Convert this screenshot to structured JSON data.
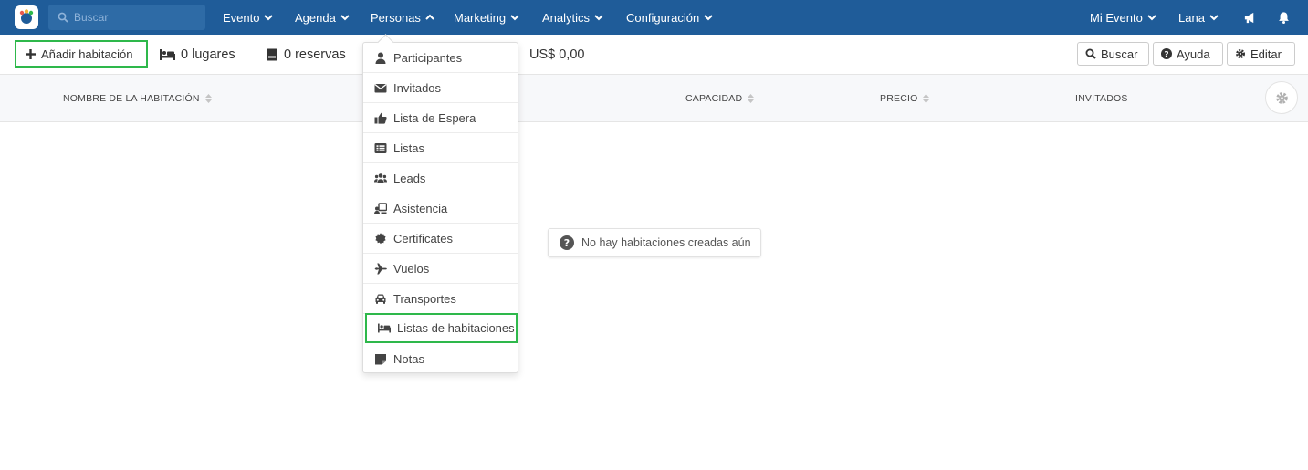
{
  "topbar": {
    "search_placeholder": "Buscar",
    "nav": [
      {
        "label": "Evento"
      },
      {
        "label": "Agenda"
      },
      {
        "label": "Personas"
      },
      {
        "label": "Marketing"
      },
      {
        "label": "Analytics"
      },
      {
        "label": "Configuración"
      }
    ],
    "right": {
      "event_label": "Mi Evento",
      "user_label": "Lana"
    },
    "colors": {
      "bar": "#1f5c99",
      "accent": "#2eb84b"
    }
  },
  "toolbar": {
    "add_label": "Añadir habitación",
    "places": "0 lugares",
    "reservations": "0 reservas",
    "amount": "US$ 0,00",
    "search_label": "Buscar",
    "help_label": "Ayuda",
    "edit_label": "Editar"
  },
  "table": {
    "columns": [
      {
        "label": "NOMBRE DE LA HABITACIÓN"
      },
      {
        "label": "CAPACIDAD"
      },
      {
        "label": "PRECIO"
      },
      {
        "label": "INVITADOS"
      }
    ]
  },
  "empty_state": "No hay habitaciones creadas aún",
  "dropdown": {
    "items": [
      {
        "label": "Participantes",
        "icon": "user-icon"
      },
      {
        "label": "Invitados",
        "icon": "envelope-icon"
      },
      {
        "label": "Lista de Espera",
        "icon": "thumbs-up-icon"
      },
      {
        "label": "Listas",
        "icon": "list-icon"
      },
      {
        "label": "Leads",
        "icon": "users-icon"
      },
      {
        "label": "Asistencia",
        "icon": "checkin-icon"
      },
      {
        "label": "Certificates",
        "icon": "certificate-icon"
      },
      {
        "label": "Vuelos",
        "icon": "plane-icon"
      },
      {
        "label": "Transportes",
        "icon": "car-icon"
      },
      {
        "label": "Listas de habitaciones",
        "icon": "bed-icon"
      },
      {
        "label": "Notas",
        "icon": "note-icon"
      }
    ]
  }
}
